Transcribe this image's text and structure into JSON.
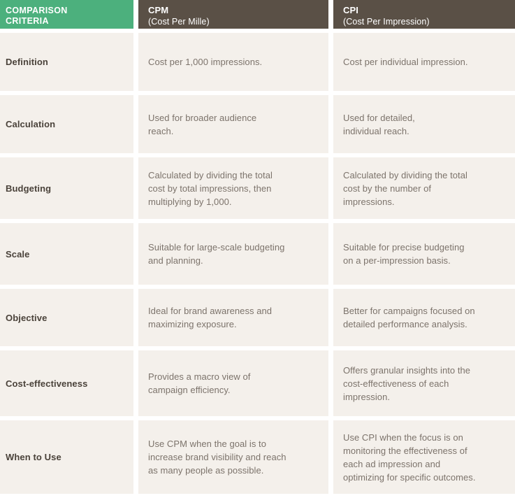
{
  "colors": {
    "criteria_header_bg": "#4cb07d",
    "value_header_bg": "#5a5046",
    "cell_bg": "#f4f0eb",
    "label_text": "#4a423a",
    "body_text": "#7c736b",
    "header_text": "#ffffff",
    "page_bg": "#ffffff"
  },
  "header": {
    "criteria": {
      "line1": "COMPARISON",
      "line2": "CRITERIA"
    },
    "cpm": {
      "abbr": "CPM",
      "expansion": "(Cost Per Mille)"
    },
    "cpi": {
      "abbr": "CPI",
      "expansion": "(Cost Per Impression)"
    }
  },
  "rows": [
    {
      "criteria": "Definition",
      "cpm": "Cost per 1,000 impressions.",
      "cpi": "Cost per individual impression."
    },
    {
      "criteria": "Calculation",
      "cpm": "Used for broader audience\nreach.",
      "cpi": "Used for detailed,\nindividual reach."
    },
    {
      "criteria": "Budgeting",
      "cpm": "Calculated by dividing the total\ncost by total impressions, then\nmultiplying by 1,000.",
      "cpi": "Calculated by dividing the total\ncost by the number of\nimpressions."
    },
    {
      "criteria": "Scale",
      "cpm": "Suitable for large-scale budgeting\nand planning.",
      "cpi": "Suitable for precise budgeting\non a per-impression basis."
    },
    {
      "criteria": "Objective",
      "cpm": "Ideal for brand awareness and\nmaximizing exposure.",
      "cpi": "Better for campaigns focused on\ndetailed performance analysis."
    },
    {
      "criteria": "Cost-effectiveness",
      "cpm": "Provides a macro view of\ncampaign efficiency.",
      "cpi": "Offers granular insights into the\ncost-effectiveness of each\nimpression."
    },
    {
      "criteria": "When to Use",
      "cpm": "Use CPM when the goal is to\nincrease brand visibility and reach\nas many people as possible.",
      "cpi": "Use CPI when the focus is on\nmonitoring the effectiveness of\neach ad impression and\noptimizing for specific outcomes."
    }
  ]
}
